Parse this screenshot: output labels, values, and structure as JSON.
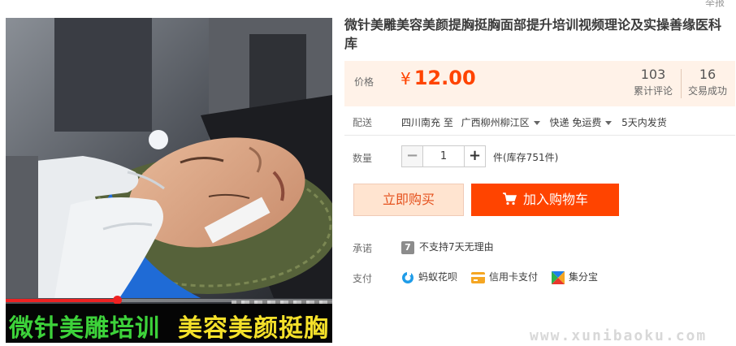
{
  "header": {
    "report_label": "举报"
  },
  "product": {
    "title": "微针美雕美容美颜提胸挺胸面部提升培训视频理论及实操善缘医科库",
    "video": {
      "caption_left": "微针美雕培训",
      "caption_right": "美容美颜挺胸",
      "progress": 0.34,
      "colors": {
        "caption_left": "#3dd23a",
        "caption_right": "#f4e02a",
        "progress": "#e22222"
      }
    }
  },
  "price": {
    "label": "价格",
    "currency": "¥",
    "value": "12.00",
    "stats": [
      {
        "number": "103",
        "label": "累计评论"
      },
      {
        "number": "16",
        "label": "交易成功"
      }
    ]
  },
  "shipping": {
    "label": "配送",
    "from": "四川南充 至",
    "to": "广西柳州柳江区",
    "method": "快递 免运费",
    "delivery": "5天内发货"
  },
  "quantity": {
    "label": "数量",
    "value": "1",
    "minus": "−",
    "plus": "+",
    "stock_text": "件(库存751件)"
  },
  "actions": {
    "buy_now": "立即购买",
    "add_to_cart": "加入购物车",
    "accent": "#ff4400"
  },
  "promise": {
    "label": "承诺",
    "icon_glyph": "7",
    "text": "不支持7天无理由"
  },
  "payment": {
    "label": "支付",
    "methods": [
      {
        "icon": "huabei-icon",
        "label": "蚂蚁花呗"
      },
      {
        "icon": "credit-card-icon",
        "label": "信用卡支付"
      },
      {
        "icon": "jifenbao-icon",
        "label": "集分宝"
      }
    ]
  },
  "watermark": "www.xunibaoku.com"
}
